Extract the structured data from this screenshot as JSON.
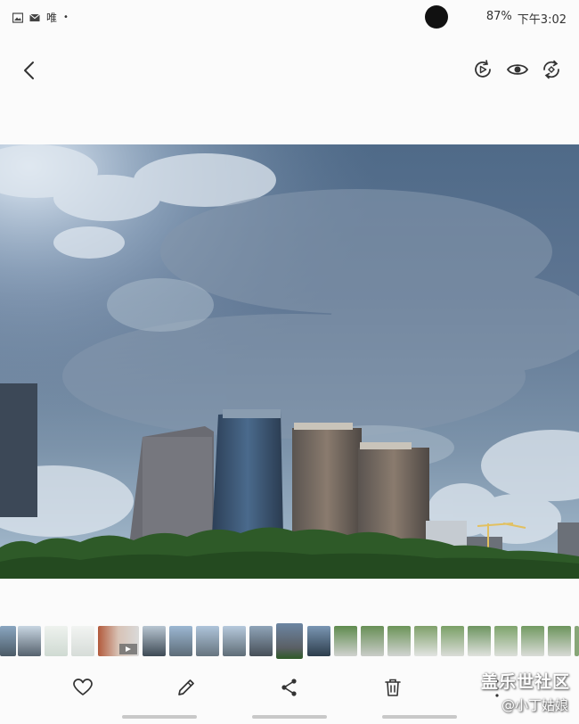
{
  "status_bar": {
    "carrier_text": "唯",
    "battery": "87%",
    "time": "下午3:02"
  },
  "toolbar": {
    "icons": [
      "back-icon",
      "motion-photo-icon",
      "eye-icon",
      "rotate-icon"
    ]
  },
  "photo": {
    "description_icon": "city-skyline-photo"
  },
  "filmstrip": {
    "count": 22,
    "active_index": 10
  },
  "bottom_bar": {
    "icons": [
      "heart-icon",
      "edit-icon",
      "share-icon",
      "delete-icon",
      "more-icon"
    ]
  },
  "watermark": {
    "title": "盖乐世社区",
    "author": "@小丁姑娘"
  }
}
